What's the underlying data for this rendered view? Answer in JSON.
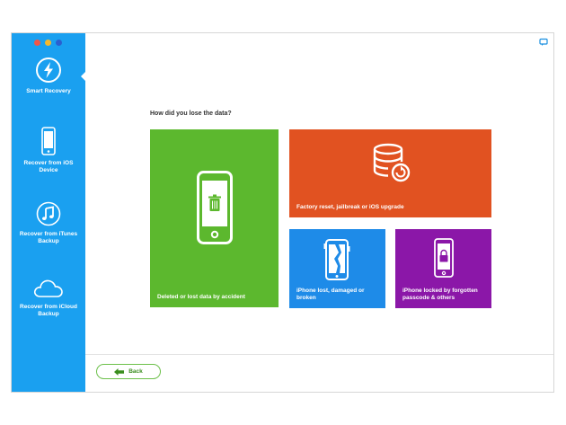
{
  "window": {
    "traffic_lights": {
      "close": "#f0564a",
      "minimize": "#f5b82e",
      "zoom": "#2a5fd0"
    }
  },
  "sidebar": {
    "bg_color": "#1aa0f0",
    "items": [
      {
        "label": "Smart Recovery",
        "icon": "lightning-icon",
        "active": true
      },
      {
        "label": "Recover from iOS Device",
        "icon": "iphone-icon",
        "active": false
      },
      {
        "label": "Recover from iTunes Backup",
        "icon": "music-note-icon",
        "active": false
      },
      {
        "label": "Recover from iCloud Backup",
        "icon": "cloud-icon",
        "active": false
      }
    ]
  },
  "main": {
    "question": "How did you lose the data?",
    "options": [
      {
        "label": "Deleted or lost data by accident",
        "icon": "phone-trash-icon",
        "color": "#5cb82e"
      },
      {
        "label": "Factory reset, jailbreak or iOS upgrade",
        "icon": "database-restore-icon",
        "color": "#e15221"
      },
      {
        "label": "iPhone lost, damaged or broken",
        "icon": "broken-phone-icon",
        "color": "#1e8be8"
      },
      {
        "label": "iPhone locked by forgotten passcode & others",
        "icon": "locked-phone-icon",
        "color": "#8b17a8"
      }
    ]
  },
  "footer": {
    "back_label": "Back",
    "back_icon": "back-arrow-icon"
  },
  "help_icon": "chat-help-icon"
}
